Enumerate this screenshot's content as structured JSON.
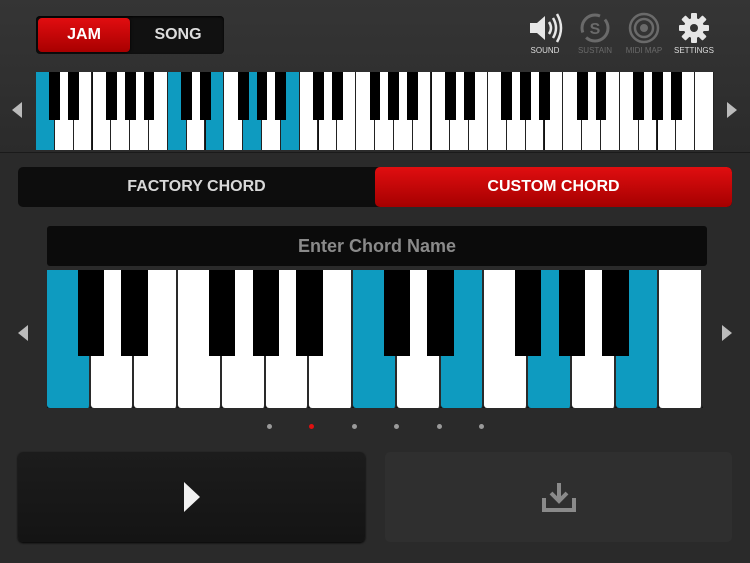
{
  "modes": {
    "jam": "JAM",
    "song": "SONG",
    "active": "jam"
  },
  "tools": [
    {
      "name": "sound",
      "label": "SOUND",
      "icon": "speaker-icon",
      "enabled": true
    },
    {
      "name": "sustain",
      "label": "SUSTAIN",
      "icon": "sustain-icon",
      "enabled": false
    },
    {
      "name": "midi-map",
      "label": "MIDI MAP",
      "icon": "target-icon",
      "enabled": false
    },
    {
      "name": "settings",
      "label": "SETTINGS",
      "icon": "gear-icon",
      "enabled": true
    }
  ],
  "mini_keyboard": {
    "white_key_count": 36,
    "highlighted_white_keys": [
      0,
      7,
      9,
      11,
      13
    ]
  },
  "chord_tabs": {
    "factory": "FACTORY CHORD",
    "custom": "CUSTOM CHORD",
    "active": "custom"
  },
  "chord_name": {
    "value": "",
    "placeholder": "Enter Chord Name"
  },
  "chord_keyboard": {
    "white_key_count": 15,
    "highlighted_white_keys": [
      0,
      7,
      9,
      11,
      13
    ]
  },
  "page_indicator": {
    "count": 6,
    "active": 1
  },
  "actions": {
    "play_icon": "play-icon",
    "save_icon": "download-icon"
  },
  "colors": {
    "accent_red": "#e10d10",
    "key_highlight": "#0e9bc0"
  }
}
